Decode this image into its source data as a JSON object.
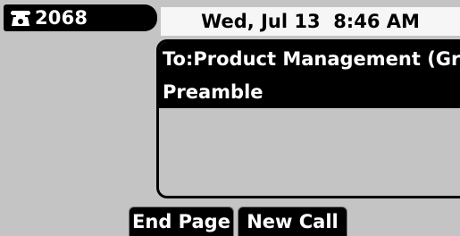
{
  "line_key": {
    "icon": "phone-icon",
    "number": "2068"
  },
  "status_bar": {
    "datetime": "Wed, Jul 13  8:46 AM"
  },
  "message_panel": {
    "to_line": "To:Product Management (Gr…",
    "subject": "Preamble"
  },
  "softkeys": [
    {
      "label": "End Page"
    },
    {
      "label": "New Call"
    }
  ]
}
